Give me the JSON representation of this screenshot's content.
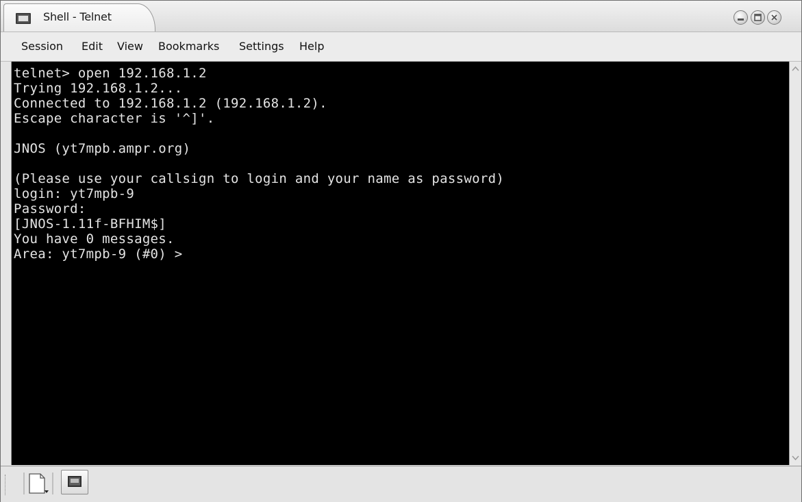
{
  "window": {
    "title": "Shell - Telnet",
    "app_icon": "terminal-icon",
    "buttons": [
      "minimize-icon",
      "maximize-icon",
      "close-icon"
    ]
  },
  "menu": {
    "items": [
      "Session",
      "Edit",
      "View",
      "Bookmarks",
      "Settings",
      "Help"
    ]
  },
  "terminal": {
    "lines": [
      "telnet> open 192.168.1.2",
      "Trying 192.168.1.2...",
      "Connected to 192.168.1.2 (192.168.1.2).",
      "Escape character is '^]'.",
      "",
      "JNOS (yt7mpb.ampr.org)",
      "",
      "(Please use your callsign to login and your name as password)",
      "login: yt7mpb-9",
      "Password:",
      "[JNOS-1.11f-BFHIM$]",
      "You have 0 messages.",
      "Area: yt7mpb-9 (#0) >"
    ]
  },
  "tabbar": {
    "new_session_icon": "new-session-icon",
    "session_icon": "terminal-icon"
  },
  "colors": {
    "terminal_bg": "#000000",
    "terminal_fg": "#e4e4e4",
    "chrome": "#e6e6e6"
  }
}
